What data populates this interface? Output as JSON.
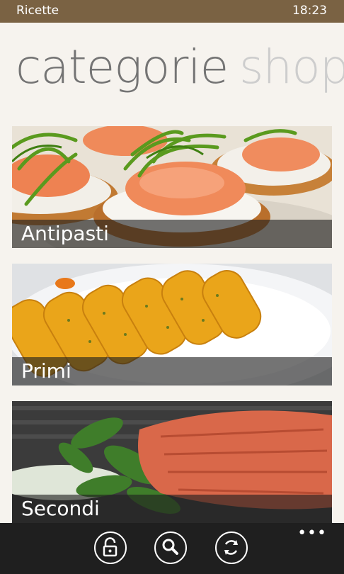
{
  "status": {
    "app_name": "Ricette",
    "time": "18:23"
  },
  "pivot": {
    "active": "categorie",
    "next": "shop"
  },
  "categories": [
    {
      "label": "Antipasti"
    },
    {
      "label": "Primi"
    },
    {
      "label": "Secondi"
    }
  ],
  "appbar": {
    "buttons": [
      "unlock-icon",
      "search-icon",
      "sync-icon"
    ],
    "more": "•••"
  },
  "colors": {
    "status_bar": "#7a6243",
    "background": "#f6f3ee",
    "app_bar": "#1f1f1f"
  }
}
